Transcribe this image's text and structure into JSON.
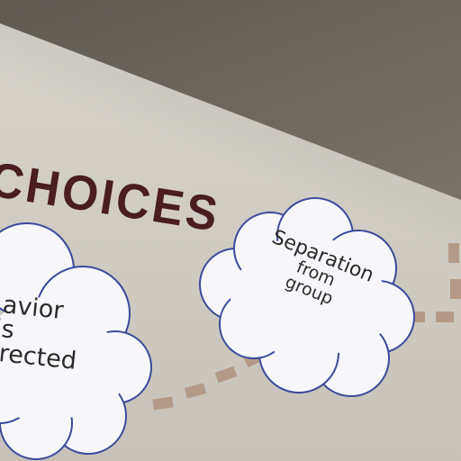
{
  "poster": {
    "title": "CHOICES",
    "cloud_right": {
      "line1": "Separation",
      "line2": "from",
      "line3": "group"
    },
    "cloud_left": {
      "line1": "avior",
      "line2": "is",
      "line3": "irected"
    }
  },
  "colors": {
    "title": "#4a1d22",
    "cloud_fill": "#f7f7fb",
    "cloud_outline": "#3b4a9c",
    "dash": "#b49a86",
    "wall": "#d2cec6",
    "ceiling": "#6e6a62"
  }
}
